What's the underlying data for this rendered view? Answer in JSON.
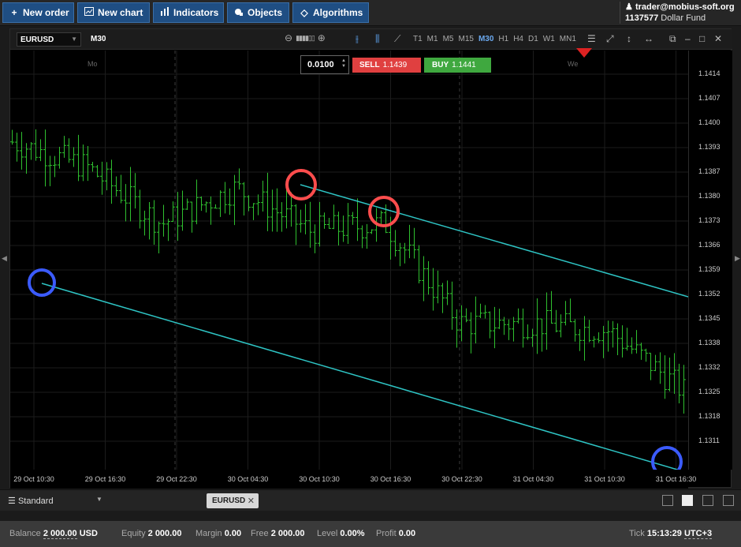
{
  "toolbar": {
    "new_order": "New order",
    "new_chart": "New chart",
    "indicators": "Indicators",
    "objects": "Objects",
    "algorithms": "Algorithms"
  },
  "account": {
    "user": "trader@mobius-soft.org",
    "number": "1137577",
    "fund": "Dollar Fund"
  },
  "chart": {
    "symbol": "EURUSD",
    "timeframe": "M30",
    "timeframes": [
      "T1",
      "M1",
      "M5",
      "M15",
      "M30",
      "H1",
      "H4",
      "D1",
      "W1",
      "MN1"
    ],
    "active_timeframe": "M30",
    "lot": "0.0100",
    "sell_label": "SELL",
    "sell_price": "1.1439",
    "buy_label": "BUY",
    "buy_price": "1.1441",
    "day_labels": [
      "Mo",
      "We"
    ],
    "y_ticks": [
      "1.1414",
      "1.1407",
      "1.1400",
      "1.1393",
      "1.1387",
      "1.1380",
      "1.1373",
      "1.1366",
      "1.1359",
      "1.1352",
      "1.1345",
      "1.1338",
      "1.1332",
      "1.1325",
      "1.1318",
      "1.1311"
    ],
    "x_ticks": [
      "29 Oct 10:30",
      "29 Oct 16:30",
      "29 Oct 22:30",
      "30 Oct 04:30",
      "30 Oct 10:30",
      "30 Oct 16:30",
      "30 Oct 22:30",
      "31 Oct 04:30",
      "31 Oct 10:30",
      "31 Oct 16:30"
    ],
    "colors": {
      "candle": "#2fc02f",
      "channel": "#2ec4c4",
      "high_marker": "#ff4d4d",
      "low_marker": "#3b5bff",
      "sell": "#e04040",
      "buy": "#3fa83f"
    }
  },
  "chart_data": {
    "type": "line",
    "title": "EURUSD M30",
    "x": [
      "29 Oct 10:30",
      "29 Oct 16:30",
      "29 Oct 22:30",
      "30 Oct 04:30",
      "30 Oct 10:30",
      "30 Oct 16:30",
      "30 Oct 22:30",
      "31 Oct 04:30",
      "31 Oct 10:30",
      "31 Oct 16:30"
    ],
    "series": [
      {
        "values": [
          1.1395,
          1.1388,
          1.1372,
          1.1382,
          1.137,
          1.1372,
          1.1344,
          1.1344,
          1.1342,
          1.1325
        ]
      }
    ],
    "ylim": [
      1.1306,
      1.142
    ]
  },
  "bottom": {
    "template": "Standard",
    "tab": "EURUSD",
    "balance_label": "Balance",
    "balance": "2 000.00",
    "balance_currency": "USD",
    "equity_label": "Equity",
    "equity": "2 000.00",
    "margin_label": "Margin",
    "margin": "0.00",
    "free_label": "Free",
    "free": "2 000.00",
    "level_label": "Level",
    "level": "0.00%",
    "profit_label": "Profit",
    "profit": "0.00",
    "tick_label": "Tick",
    "time": "15:13:29",
    "tz": "UTC+3"
  }
}
